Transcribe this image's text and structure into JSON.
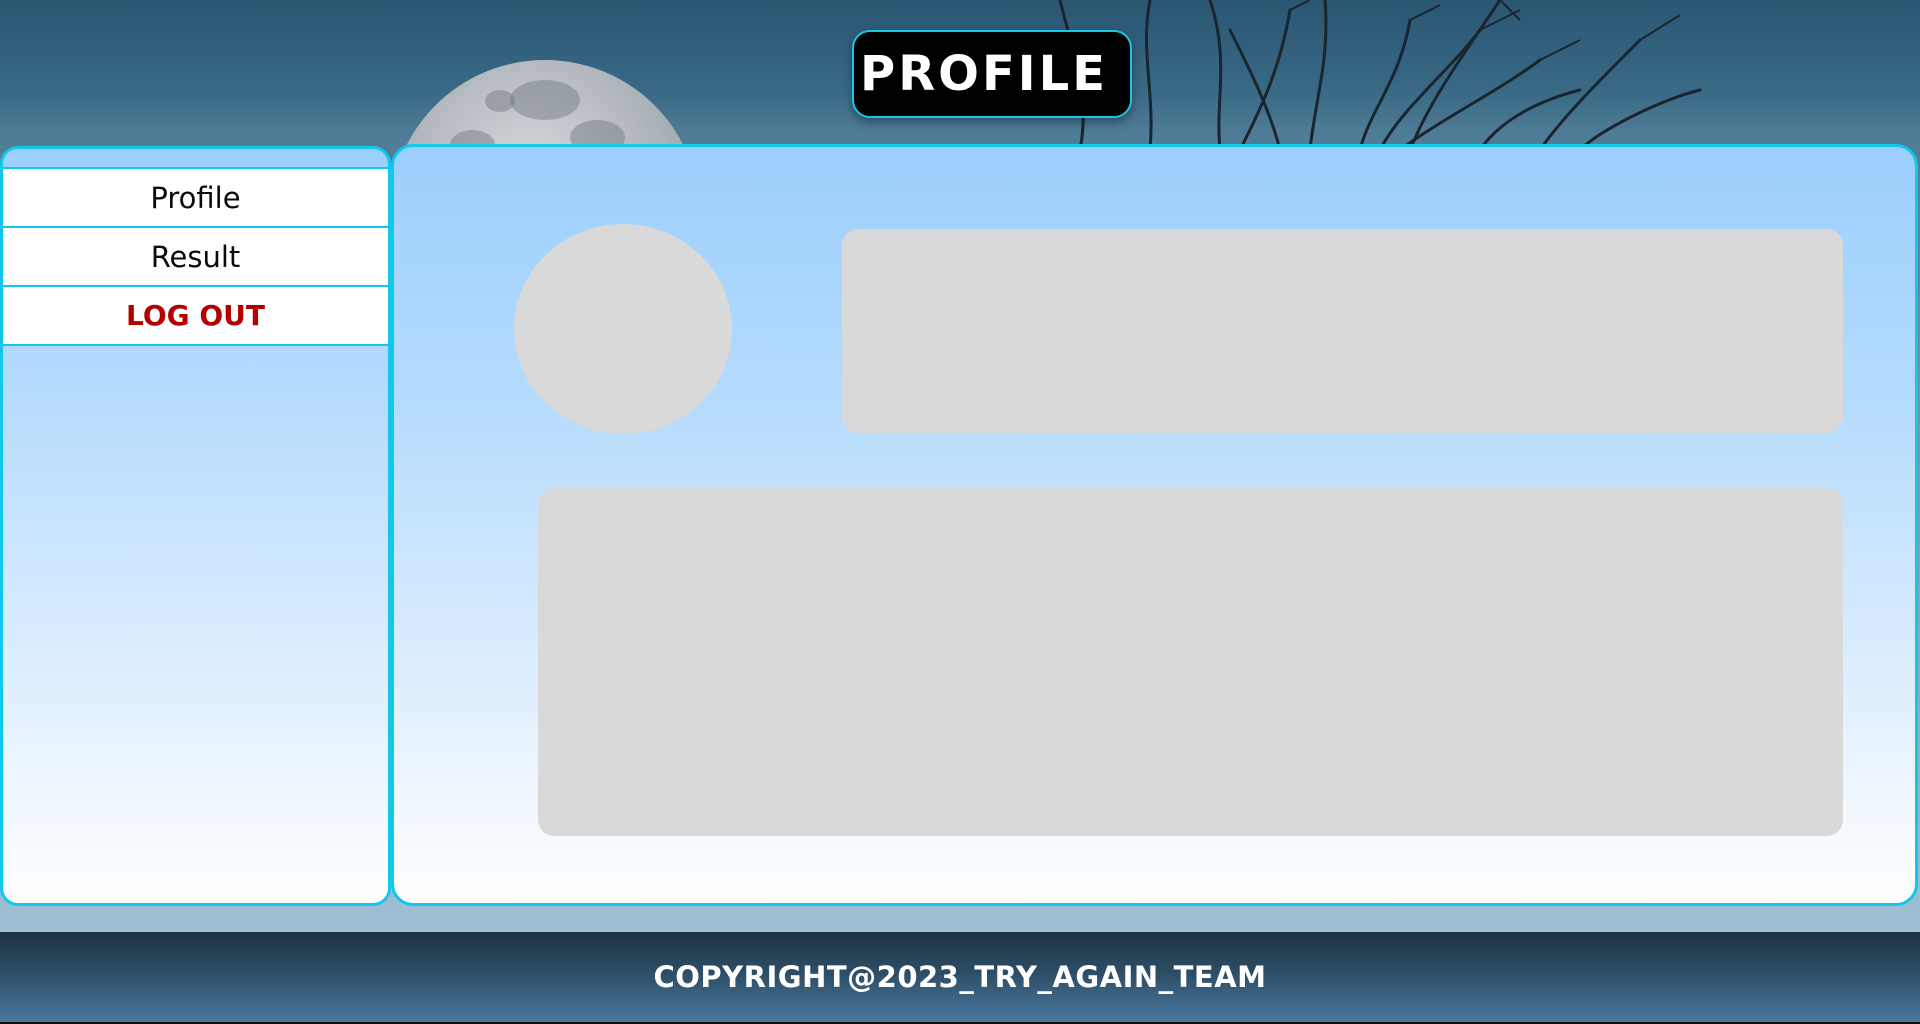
{
  "header": {
    "title": "PROFILE"
  },
  "sidebar": {
    "items": [
      {
        "label": "Profile"
      },
      {
        "label": "Result"
      },
      {
        "label": "LOG OUT"
      }
    ]
  },
  "footer": {
    "copyright": "COPYRIGHT@2023_TRY_AGAIN_TEAM"
  },
  "colors": {
    "accent_border": "#12c8ea",
    "logout_text": "#b30000",
    "placeholder_gray": "#d9d9d9",
    "title_bg": "#000000"
  }
}
